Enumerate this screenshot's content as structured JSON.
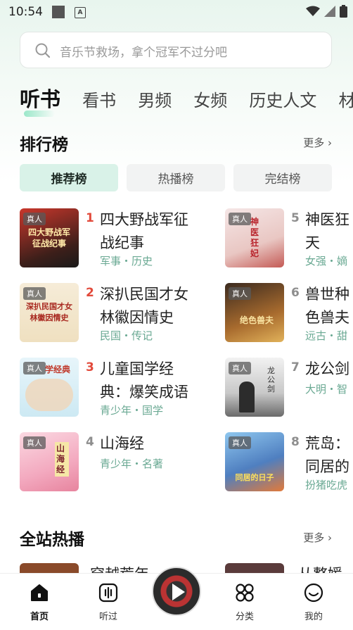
{
  "status": {
    "time": "10:54"
  },
  "search": {
    "placeholder": "音乐节救场，拿个冠军不过分吧"
  },
  "tabs": [
    {
      "label": "听书"
    },
    {
      "label": "看书"
    },
    {
      "label": "男频"
    },
    {
      "label": "女频"
    },
    {
      "label": "历史人文"
    },
    {
      "label": "材"
    }
  ],
  "ranking": {
    "title": "排行榜",
    "more": "更多",
    "chips": [
      "推荐榜",
      "热播榜",
      "完结榜"
    ],
    "badge": "真人",
    "items": [
      {
        "rank": "1",
        "title": "四大野战军征战纪事",
        "tags": "军事・历史",
        "cover_text": "四大野战军 征战纪事"
      },
      {
        "rank": "2",
        "title": "深扒民国才女林徽因情史",
        "tags": "民国・传记",
        "cover_text": "深扒民国才女 林徽因情史"
      },
      {
        "rank": "3",
        "title": "儿童国学经典：爆笑成语",
        "tags": "青少年・国学",
        "cover_text": "学经典"
      },
      {
        "rank": "4",
        "title": "山海经",
        "tags": "青少年・名著",
        "cover_text": "山海经"
      },
      {
        "rank": "5",
        "title": "神医狂天",
        "tags": "女强・嫡",
        "cover_text": "神医狂妃"
      },
      {
        "rank": "6",
        "title": "兽世种色兽夫",
        "tags": "远古・甜",
        "cover_text": "绝色兽夫"
      },
      {
        "rank": "7",
        "title": "龙公剑",
        "tags": "大明・智",
        "cover_text": "龙公剑"
      },
      {
        "rank": "8",
        "title": "荒岛：同居的",
        "tags": "扮猪吃虎",
        "cover_text": "同居的日子"
      }
    ]
  },
  "hot": {
    "title": "全站热播",
    "more": "更多",
    "peek": [
      "穿越荒年",
      "从整媛驾"
    ]
  },
  "bottom_nav": [
    {
      "label": "首页",
      "icon": "home-icon"
    },
    {
      "label": "听过",
      "icon": "history-icon"
    },
    {
      "label": "分类",
      "icon": "category-icon"
    },
    {
      "label": "我的",
      "icon": "profile-icon"
    }
  ],
  "colors": {
    "accent": "#6aa993",
    "rank_red": "#e24a3b",
    "chip_active": "#d9f2e8"
  }
}
